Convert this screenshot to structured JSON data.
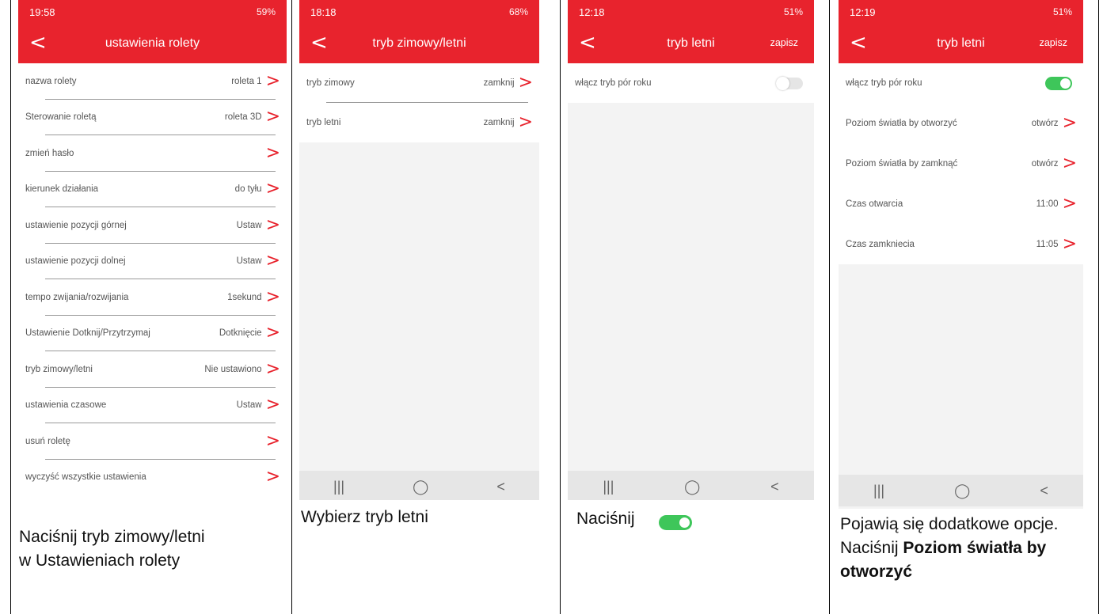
{
  "panel1": {
    "status_time": "19:58",
    "status_right": "59%",
    "title": "ustawienia rolety",
    "rows": [
      {
        "label": "nazwa rolety",
        "value": "roleta 1"
      },
      {
        "label": "Sterowanie roletą",
        "value": "roleta 3D"
      },
      {
        "label": "zmień hasło",
        "value": ""
      },
      {
        "label": "kierunek działania",
        "value": "do tyłu"
      },
      {
        "label": "ustawienie pozycji górnej",
        "value": "Ustaw"
      },
      {
        "label": "ustawienie pozycji dolnej",
        "value": "Ustaw"
      },
      {
        "label": "tempo zwijania/rozwijania",
        "value": "1sekund"
      },
      {
        "label": "Ustawienie Dotknij/Przytrzymaj",
        "value": "Dotknięcie"
      },
      {
        "label": "tryb zimowy/letni",
        "value": "Nie ustawiono"
      },
      {
        "label": "ustawienia czasowe",
        "value": "Ustaw"
      },
      {
        "label": "usuń roletę",
        "value": ""
      },
      {
        "label": "wyczyść wszystkie ustawienia",
        "value": ""
      }
    ],
    "caption_line1": "Naciśnij tryb zimowy/letni",
    "caption_line2": "w Ustawieniach rolety"
  },
  "panel2": {
    "status_time": "18:18",
    "status_right": "68%",
    "title": "tryb zimowy/letni",
    "rows": [
      {
        "label": "tryb zimowy",
        "value": "zamknij"
      },
      {
        "label": "tryb letni",
        "value": "zamknij"
      }
    ],
    "caption": "Wybierz tryb letni"
  },
  "panel3": {
    "status_time": "12:18",
    "status_right": "51%",
    "title": "tryb letni",
    "save": "zapisz",
    "toggle_label": "włącz tryb pór roku",
    "caption": "Naciśnij"
  },
  "panel4": {
    "status_time": "12:19",
    "status_right": "51%",
    "title": "tryb letni",
    "save": "zapisz",
    "toggle_label": "włącz tryb pór roku",
    "rows": [
      {
        "label": "Poziom światła by otworzyć",
        "value": "otwórz"
      },
      {
        "label": "Poziom światła by zamknąć",
        "value": "otwórz"
      },
      {
        "label": "Czas otwarcia",
        "value": "11:00"
      },
      {
        "label": "Czas zamkniecia",
        "value": "11:05"
      }
    ],
    "caption_a": "Pojawią się dodatkowe opcje. Naciśnij ",
    "caption_b": "Poziom światła by otworzyć"
  },
  "nav": {
    "recents": "|||",
    "home": "◯",
    "back": "<"
  },
  "icons": {
    "back": "chevron-left-icon",
    "chevron": "chevron-right-icon"
  },
  "colors": {
    "accent": "#e8232d",
    "toggle_on": "#3ec65a"
  }
}
